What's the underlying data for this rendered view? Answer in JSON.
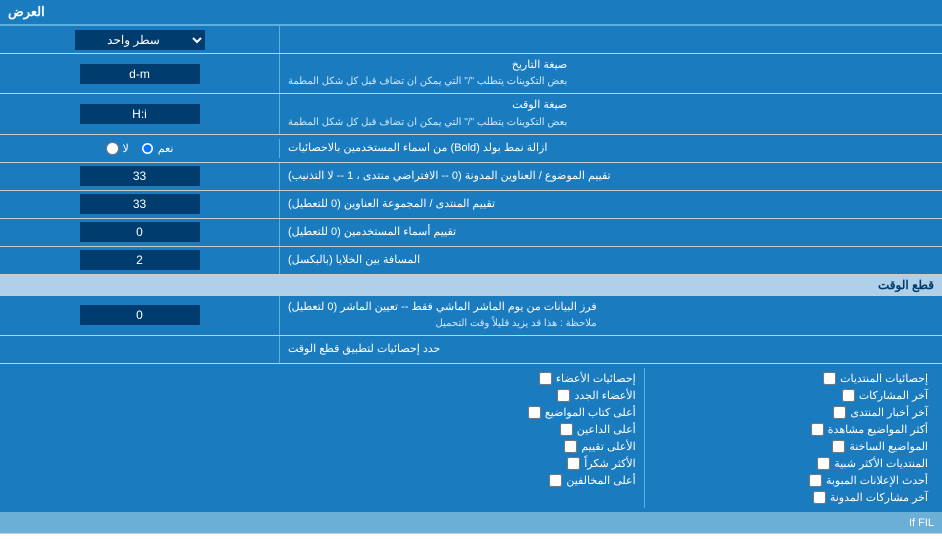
{
  "header": {
    "title": "العرض",
    "dropdown_label": "سطر واحد"
  },
  "rows": [
    {
      "id": "date_format",
      "label": "صيغة التاريخ",
      "sublabel": "بعض التكوينات يتطلب \"/\" التي يمكن ان تضاف قبل كل شكل المطمة",
      "input_value": "d-m",
      "input_type": "text"
    },
    {
      "id": "time_format",
      "label": "صيغة الوقت",
      "sublabel": "بعض التكوينات يتطلب \"/\" التي يمكن ان تضاف قبل كل شكل المطمة",
      "input_value": "H:i",
      "input_type": "text"
    },
    {
      "id": "bold_remove",
      "label": "ازالة نمط بولد (Bold) من اسماء المستخدمين بالاحصائيات",
      "input_type": "radio",
      "radio_options": [
        {
          "value": "yes",
          "label": "نعم",
          "checked": true
        },
        {
          "value": "no",
          "label": "لا",
          "checked": false
        }
      ]
    },
    {
      "id": "topic_address_sort",
      "label": "تقييم الموضوع / العناوين المدونة (0 -- الافتراضي منتدى ، 1 -- لا التذنيب)",
      "input_value": "33",
      "input_type": "text"
    },
    {
      "id": "forum_address_sort",
      "label": "تقييم المنتدى / المجموعة العناوين (0 للتعطيل)",
      "input_value": "33",
      "input_type": "text"
    },
    {
      "id": "username_sort",
      "label": "تقييم أسماء المستخدمين (0 للتعطيل)",
      "input_value": "0",
      "input_type": "text"
    },
    {
      "id": "gap_between",
      "label": "المسافة بين الخلايا (بالبكسل)",
      "input_value": "2",
      "input_type": "text"
    }
  ],
  "time_section": {
    "title": "قطع الوقت",
    "row": {
      "label": "فرز البيانات من يوم الماشر الماشي فقط -- تعيين الماشر (0 لتعطيل)",
      "sublabel": "ملاحظة : هذا قد يزيد قليلاً وقت التحميل",
      "input_value": "0",
      "input_type": "text"
    }
  },
  "stats_section": {
    "label": "حدد إحصائيات لتطبيق قطع الوقت",
    "columns": [
      {
        "header": "",
        "items": [
          {
            "label": "إحصائيات المنتديات"
          },
          {
            "label": "آخر المشاركات"
          },
          {
            "label": "آخر أخبار المنتدى"
          },
          {
            "label": "أكثر المواضيع مشاهدة"
          },
          {
            "label": "المواضيع الساخنة"
          },
          {
            "label": "المنتديات الأكثر شبية"
          },
          {
            "label": "أحدث الإعلانات المبوبة"
          },
          {
            "label": "آخر مشاركات المدونة"
          }
        ]
      },
      {
        "header": "",
        "items": [
          {
            "label": "إحصائيات الأعضاء"
          },
          {
            "label": "الأعضاء الجدد"
          },
          {
            "label": "أعلى كتاب المواضيع"
          },
          {
            "label": "أعلى الداعين"
          },
          {
            "label": "الأعلى تقييم"
          },
          {
            "label": "الأكثر شكراً"
          },
          {
            "label": "أعلى المخالفين"
          }
        ]
      }
    ]
  },
  "filter_text": "If FIL"
}
